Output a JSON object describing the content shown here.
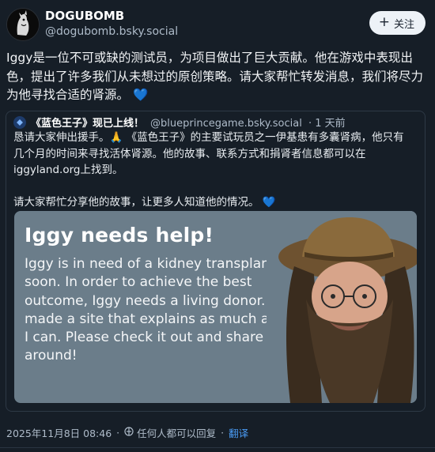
{
  "author": {
    "display_name": "DOGUBOMB",
    "handle": "@dogubomb.bsky.social",
    "avatar_icon": "dog-avatar-icon"
  },
  "follow": {
    "label": "关注",
    "icon": "plus-icon"
  },
  "post": {
    "text": "Iggy是一位不可或缺的测试员，为项目做出了巨大贡献。他在游戏中表现出色，提出了许多我们从未想过的原创策略。请大家帮忙转发消息，我们将尽力为他寻找合适的肾源。",
    "emoji": "💙"
  },
  "quote": {
    "name": "《蓝色王子》现已上线！",
    "handle": "@blueprincegame.bsky.social",
    "time": "· 1 天前",
    "line1": "恳请大家伸出援手。🙏 《蓝色王子》的主要试玩员之一伊基患有多囊肾病，他只有几个月的时间来寻找活体肾源。他的故事、联系方式和捐肾者信息都可以在iggyland.org上找到。",
    "line2": "请大家帮忙分享他的故事，让更多人知道他的情况。",
    "emoji": "💙",
    "card": {
      "title": "Iggy needs help!",
      "body": "Iggy is in need of a kidney transplant soon. In order to achieve the best outcome, Iggy needs a living donor. I made a site that explains as much as I can. Please check it out and share it around!"
    }
  },
  "footer": {
    "timestamp": "2025年11月8日 08:46",
    "reply_setting": "任何人都可以回复",
    "dot": "·",
    "translate": "翻译"
  },
  "colors": {
    "background": "#161e27",
    "accent": "#3b8de6",
    "card": "#6b7d8a"
  }
}
